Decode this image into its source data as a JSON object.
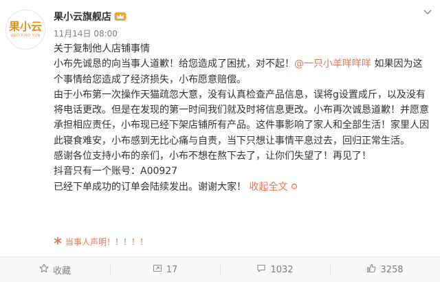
{
  "header": {
    "avatar_logo": "果小云",
    "avatar_sub": "GUO XIAO YUN",
    "author": "果小云旗舰店",
    "badge_icon": "vip-crown-icon",
    "time": "11月14日 08:00",
    "menu_icon": "chevron-down-icon"
  },
  "content": {
    "title": "关于复制他人店铺事情",
    "p1_before": "小布先诚恳的向当事人道歉！给您造成了困扰，对不起！",
    "p1_mention": "@一只小羊咩咩咩",
    "p1_after": " 如果因为这个事情给您造成了经济损失，小布愿意赔偿。",
    "p2": "由于小布第一次操作天猫疏忽大意，没有认真检查产品信息，误将g设置成斤，以及没有将电话更改。但是在发现的第一时间我们就及时将信息更改。小布再次诚恳道歉！并愿意承担相应责任，小布现已经下架店铺所有产品。这件事影响了家人和全部生活！家里人因此寝食难安，小布感到无比心痛与自责，当下只想让事情平息过去，回归正常生活。",
    "p3": "感谢各位支持小布的亲们，小布不想在熬下去了，让你们失望了！再见了！",
    "p4": "抖音只有一个账号：A00927",
    "p5": "已经下单成功的订单会陆续发出。谢谢大家！",
    "collapse": "收起全文",
    "collapse_icon": "circle-icon"
  },
  "notice": {
    "icon": "asterisk-icon",
    "text": "当事人声明！！！！！"
  },
  "actions": {
    "favorite_label": "收藏",
    "repost_count": "17",
    "comment_count": "1032",
    "like_count": "3258"
  },
  "colors": {
    "accent": "#eb7350",
    "brand_orange": "#e8901a",
    "muted": "#808080"
  }
}
